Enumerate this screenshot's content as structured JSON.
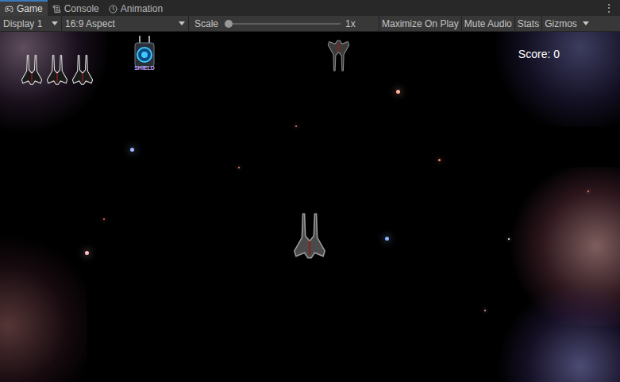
{
  "tabs": [
    {
      "label": "Game",
      "selected": true
    },
    {
      "label": "Console",
      "selected": false
    },
    {
      "label": "Animation",
      "selected": false
    }
  ],
  "menu": "⋮",
  "toolbar": {
    "display": "Display 1",
    "aspect": "16:9 Aspect",
    "scale": {
      "label": "Scale",
      "level": 0,
      "reading": "1x"
    },
    "toggles": [
      {
        "label": "Maximize On Play",
        "selected": false
      },
      {
        "label": "Mute Audio",
        "selected": false
      },
      {
        "label": "Stats",
        "selected": false
      },
      {
        "label": "Gizmos",
        "selected": false
      }
    ]
  },
  "game": {
    "score": "Score: 0",
    "lives": 3,
    "powerup": {
      "label": "SHIELD"
    }
  }
}
